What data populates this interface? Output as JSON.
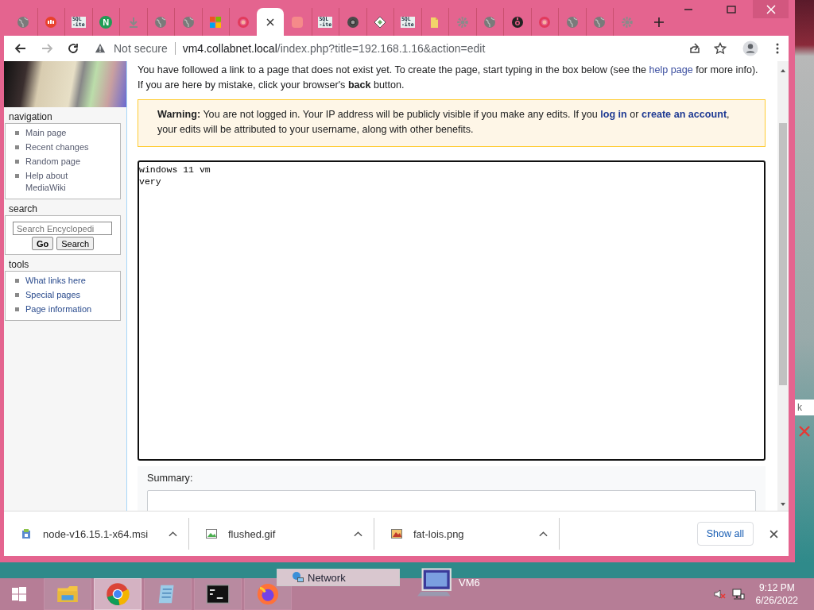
{
  "tabs": [
    {
      "kind": "globe",
      "selected": false
    },
    {
      "kind": "red-app",
      "selected": false
    },
    {
      "kind": "sqlite",
      "favicon_text": [
        "SQL",
        "-ite"
      ],
      "selected": false
    },
    {
      "kind": "letter",
      "favicon_text": [
        "N"
      ],
      "selected": false
    },
    {
      "kind": "download",
      "selected": false
    },
    {
      "kind": "globe",
      "selected": false
    },
    {
      "kind": "globe",
      "selected": false
    },
    {
      "kind": "windows",
      "selected": false
    },
    {
      "kind": "ring",
      "selected": false
    },
    {
      "selected": true
    },
    {
      "kind": "blurred",
      "selected": false
    },
    {
      "kind": "sqlite",
      "favicon_text": [
        "SQL",
        "-ite"
      ],
      "selected": false
    },
    {
      "kind": "dark-circle",
      "selected": false
    },
    {
      "kind": "diamond",
      "selected": false
    },
    {
      "kind": "sqlite",
      "favicon_text": [
        "SQL",
        "-ite"
      ],
      "selected": false
    },
    {
      "kind": "folder",
      "selected": false
    },
    {
      "kind": "gear",
      "selected": false
    },
    {
      "kind": "globe",
      "selected": false
    },
    {
      "kind": "eye",
      "selected": false
    },
    {
      "kind": "ring",
      "selected": false
    },
    {
      "kind": "globe",
      "selected": false
    },
    {
      "kind": "globe",
      "selected": false
    },
    {
      "kind": "gear",
      "selected": false
    }
  ],
  "nav_buttons": [
    {
      "kind": "back",
      "disabled": false
    },
    {
      "kind": "forward",
      "disabled": true
    },
    {
      "kind": "reload",
      "disabled": false
    }
  ],
  "address_bar": {
    "security": "Not secure",
    "host": "vm4.collabnet.local",
    "path": "/index.php?title=192.168.1.16&action=edit"
  },
  "sidebar": {
    "portlets": [
      {
        "kind": "links",
        "title": "navigation",
        "items": [
          {
            "label": "Main page",
            "visited": true
          },
          {
            "label": "Recent changes",
            "visited": true
          },
          {
            "label": "Random page",
            "visited": true
          },
          {
            "label": "Help about MediaWiki",
            "visited": true
          }
        ]
      },
      {
        "kind": "search",
        "title": "search",
        "placeholder": "Search Encyclopedi",
        "buttons": [
          "Go",
          "Search"
        ]
      },
      {
        "kind": "links",
        "title": "tools",
        "items": [
          {
            "label": "What links here",
            "visited": false
          },
          {
            "label": "Special pages",
            "visited": false
          },
          {
            "label": "Page information",
            "visited": false
          }
        ]
      }
    ]
  },
  "intro": [
    {
      "text": "You have followed a link to a page that does not exist yet. To create the page, start typing in the box below (see the "
    },
    {
      "text": "help page",
      "link": true
    },
    {
      "text": " for more info). If you are here by mistake, click your browser's **back** button."
    }
  ],
  "warning": [
    {
      "text": "**Warning:** You are not logged in. Your IP address will be publicly visible if you make any edits. If you "
    },
    {
      "text": "log in",
      "link": true
    },
    {
      "text": " or "
    },
    {
      "text": "create an account",
      "link": true
    },
    {
      "text": ", your edits will be attributed to your username, along with other benefits."
    }
  ],
  "editor": {
    "value": "windows 11 vm\nvery"
  },
  "summary": {
    "label": "Summary:"
  },
  "downloads": {
    "items": [
      {
        "name": "node-v16.15.1-x64.msi",
        "kind": "installer"
      },
      {
        "name": "flushed.gif",
        "kind": "image"
      },
      {
        "name": "fat-lois.png",
        "kind": "image-red"
      }
    ],
    "show_all": "Show all"
  },
  "background_window": {
    "text": "k"
  },
  "desktop": {
    "network": "Network",
    "computer": "VM6"
  },
  "taskbar": {
    "apps": [
      {
        "kind": "explorer",
        "selected": false
      },
      {
        "kind": "chrome",
        "selected": true
      },
      {
        "kind": "notepad",
        "selected": false
      },
      {
        "kind": "terminal",
        "selected": false
      },
      {
        "kind": "firefox",
        "selected": false
      }
    ],
    "time": "9:12 PM",
    "date": "6/26/2022"
  }
}
